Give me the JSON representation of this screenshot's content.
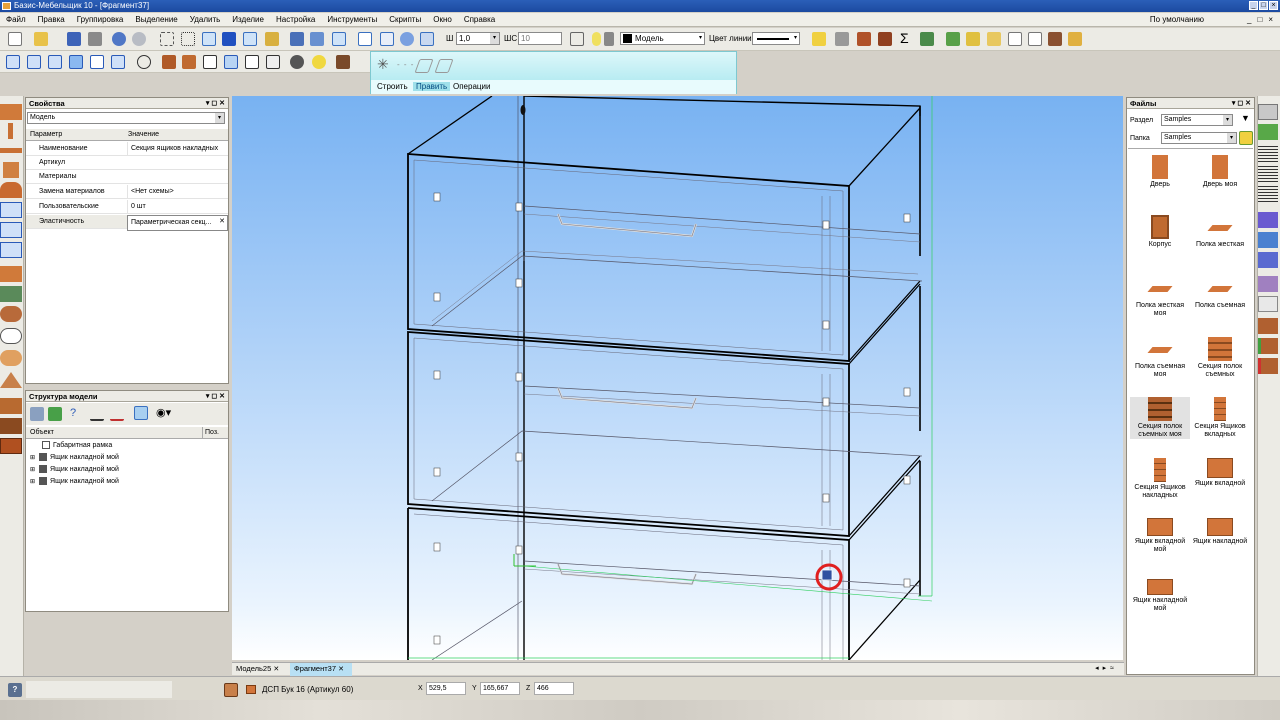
{
  "window": {
    "title": "Базис-Мебельщик 10 - [Фрагмент37]"
  },
  "menu": {
    "items": [
      "Файл",
      "Правка",
      "Группировка",
      "Выделение",
      "Удалить",
      "Изделие",
      "Настройка",
      "Инструменты",
      "Скрипты",
      "Окно",
      "Справка"
    ],
    "right_label": "По умолчанию"
  },
  "toolbar": {
    "thickness_label": "Ш",
    "thickness_value": "1,0",
    "step_label": "ШС",
    "step_value": "10",
    "layer_value": "Модель",
    "line_color_label": "Цвет линии"
  },
  "tool_tabs": [
    "Строить",
    "Править",
    "Операции"
  ],
  "properties": {
    "title": "Свойства",
    "selector": "Модель",
    "col_param": "Параметр",
    "col_value": "Значение",
    "rows": [
      {
        "k": "Наименование",
        "v": "Секция ящиков накладных"
      },
      {
        "k": "Артикул",
        "v": ""
      },
      {
        "k": "Материалы",
        "v": ""
      },
      {
        "k": "Замена материалов",
        "v": "<Нет схемы>"
      },
      {
        "k": "Пользовательские",
        "v": "0 шт"
      },
      {
        "k": "Эластичность",
        "v": "Параметрическая секц..."
      }
    ]
  },
  "structure": {
    "title": "Структура модели",
    "col_object": "Объект",
    "col_pos": "Поз.",
    "items": [
      "Габаритная рамка",
      "Ящик накладной мой",
      "Ящик накладной мой",
      "Ящик накладной мой"
    ]
  },
  "files": {
    "title": "Файлы",
    "section_label": "Раздел",
    "section_value": "Samples",
    "folder_label": "Папка",
    "folder_value": "Samples",
    "items": [
      "Дверь",
      "Дверь моя",
      "Корпус",
      "Полка жесткая",
      "Полка жесткая моя",
      "Полка съемная",
      "Полка съемная моя",
      "Секция полок съемных",
      "Секция полок съемных моя",
      "Секция Ящиков вкладных",
      "Секция Ящиков накладных",
      "Ящик вкладной",
      "Ящик вкладной мой",
      "Ящик накладной",
      "Ящик накладной мой"
    ]
  },
  "doc_tabs": [
    "Модель25",
    "Фрагмент37"
  ],
  "status": {
    "material": "ДСП Бук 16 (Артикул 60)",
    "x_label": "X",
    "x": "529,5",
    "y_label": "Y",
    "y": "165,667",
    "z_label": "Z",
    "z": "466"
  },
  "colors": {
    "viewport_top": "#7cb4f4",
    "viewport_bottom": "#ffffff",
    "wood": "#d2753a",
    "titlebar": "#1c4aa0",
    "accent": "#36c8d8"
  }
}
